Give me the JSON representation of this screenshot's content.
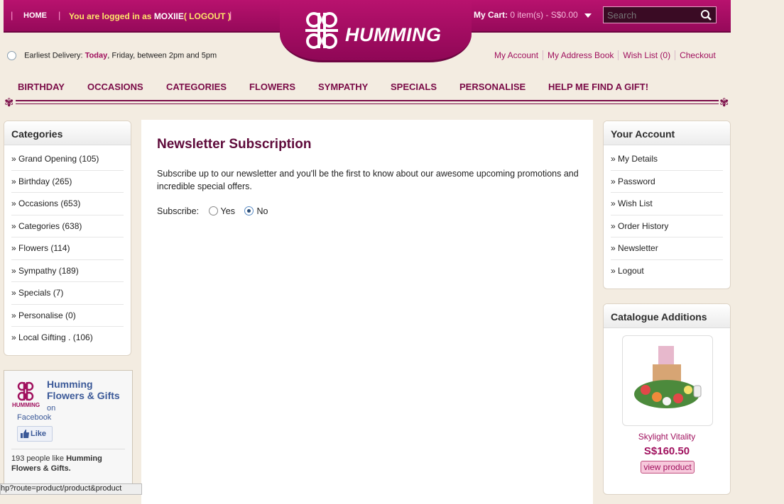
{
  "header": {
    "home": "HOME",
    "login_prefix": "You are logged in as",
    "username": "MOXIIE",
    "logout": "( LOGOUT )",
    "cart_label": "My Cart:",
    "cart_value": "0 item(s) - S$0.00",
    "search_placeholder": "Search",
    "brand": "HUMMING"
  },
  "delivery": {
    "label": "Earliest Delivery:",
    "today": "Today",
    "rest": ", Friday, between 2pm and 5pm"
  },
  "account_links": [
    "My Account",
    "My Address Book",
    "Wish List (0)",
    "Checkout"
  ],
  "nav": [
    "BIRTHDAY",
    "OCCASIONS",
    "CATEGORIES",
    "FLOWERS",
    "SYMPATHY",
    "SPECIALS",
    "PERSONALISE",
    "HELP ME FIND A GIFT!"
  ],
  "categories": {
    "title": "Categories",
    "items": [
      "» Grand Opening (105)",
      "» Birthday (265)",
      "» Occasions (653)",
      "» Categories (638)",
      "» Flowers (114)",
      "» Sympathy (189)",
      "» Specials (7)",
      "» Personalise (0)",
      "» Local Gifting . (106)"
    ]
  },
  "content": {
    "title": "Newsletter Subscription",
    "intro": "Subscribe up to our newsletter and you'll be the first to know about our awesome upcoming promotions and incredible special offers.",
    "subscribe_label": "Subscribe:",
    "yes": "Yes",
    "no": "No",
    "selected": "No"
  },
  "your_account": {
    "title": "Your Account",
    "items": [
      "» My Details",
      "» Password",
      "» Wish List",
      "» Order History",
      "» Newsletter",
      "» Logout"
    ]
  },
  "catalogue": {
    "title": "Catalogue Additions",
    "product_name": "Skylight Vitality",
    "price": "S$160.50",
    "button": "view product"
  },
  "facebook": {
    "page_name": "Humming Flowers & Gifts",
    "on": "on",
    "platform": "Facebook",
    "like": "Like",
    "likes_count": "193 people like",
    "likes_name": "Humming Flowers & Gifts."
  },
  "statusbar": "hp?route=product/product&product"
}
